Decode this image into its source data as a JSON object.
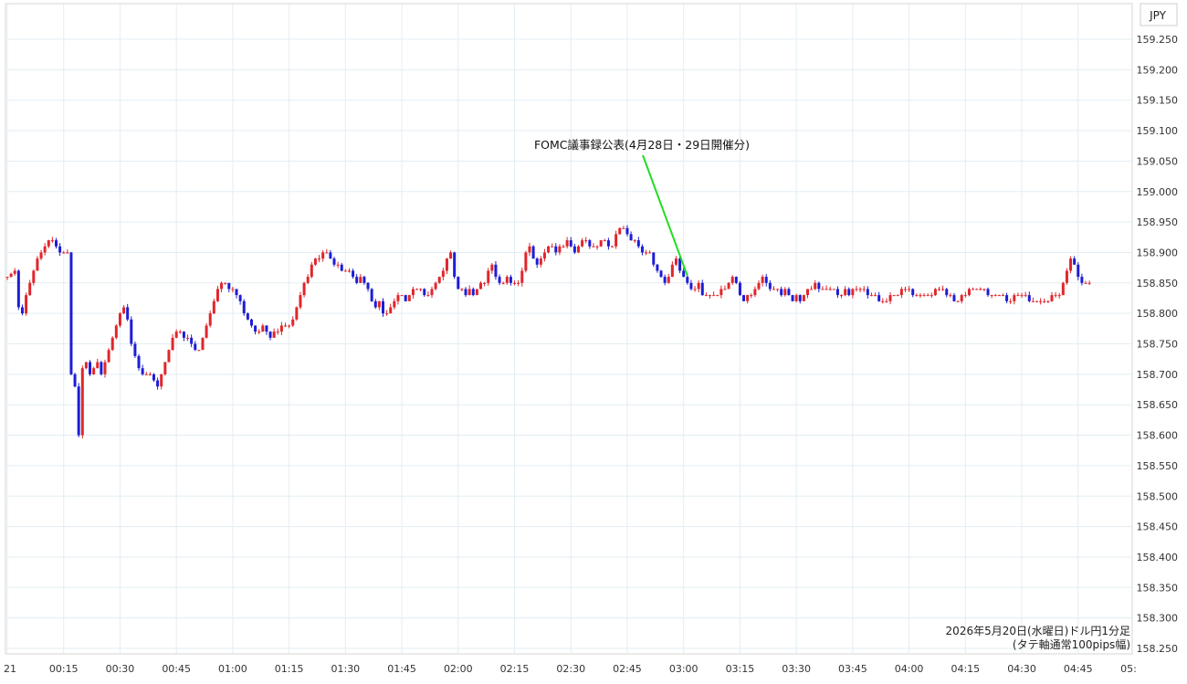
{
  "chart_data": {
    "type": "candlestick",
    "currency_label": "JPY",
    "annotation": "FOMC議事録公表(4月28日・29日開催分)",
    "caption_line1": "2026年5月20日(水曜日)ドル円1分足",
    "caption_line2": "(タテ軸通常100pips幅)",
    "ylim": [
      158.25,
      159.25
    ],
    "y_ticks": [
      "159.250",
      "159.200",
      "159.150",
      "159.100",
      "159.050",
      "159.000",
      "158.950",
      "158.900",
      "158.850",
      "158.800",
      "158.750",
      "158.700",
      "158.650",
      "158.600",
      "158.550",
      "158.500",
      "158.450",
      "158.400",
      "158.350",
      "158.300",
      "158.250"
    ],
    "x_ticks": [
      {
        "minute": 0,
        "label": "21"
      },
      {
        "minute": 15,
        "label": "00:15"
      },
      {
        "minute": 30,
        "label": "00:30"
      },
      {
        "minute": 45,
        "label": "00:45"
      },
      {
        "minute": 60,
        "label": "01:00"
      },
      {
        "minute": 75,
        "label": "01:15"
      },
      {
        "minute": 90,
        "label": "01:30"
      },
      {
        "minute": 105,
        "label": "01:45"
      },
      {
        "minute": 120,
        "label": "02:00"
      },
      {
        "minute": 135,
        "label": "02:15"
      },
      {
        "minute": 150,
        "label": "02:30"
      },
      {
        "minute": 165,
        "label": "02:45"
      },
      {
        "minute": 180,
        "label": "03:00"
      },
      {
        "minute": 195,
        "label": "03:15"
      },
      {
        "minute": 210,
        "label": "03:30"
      },
      {
        "minute": 225,
        "label": "03:45"
      },
      {
        "minute": 240,
        "label": "04:00"
      },
      {
        "minute": 255,
        "label": "04:15"
      },
      {
        "minute": 270,
        "label": "04:30"
      },
      {
        "minute": 285,
        "label": "04:45"
      },
      {
        "minute": 300,
        "label": "05:"
      }
    ],
    "annotation_minute": 181,
    "up_color": "#e0262b",
    "down_color": "#1d1dd6",
    "arrow_color": "#22dd22",
    "grid": true,
    "close_path": [
      [
        0,
        158.86
      ],
      [
        2,
        158.87
      ],
      [
        3,
        158.81
      ],
      [
        4,
        158.8
      ],
      [
        5,
        158.83
      ],
      [
        6,
        158.85
      ],
      [
        7,
        158.87
      ],
      [
        8,
        158.89
      ],
      [
        9,
        158.9
      ],
      [
        10,
        158.91
      ],
      [
        11,
        158.92
      ],
      [
        12,
        158.92
      ],
      [
        13,
        158.91
      ],
      [
        14,
        158.9
      ],
      [
        15,
        158.9
      ],
      [
        16,
        158.9
      ],
      [
        17,
        158.7
      ],
      [
        18,
        158.68
      ],
      [
        19,
        158.6
      ],
      [
        20,
        158.71
      ],
      [
        21,
        158.72
      ],
      [
        22,
        158.7
      ],
      [
        23,
        158.71
      ],
      [
        24,
        158.72
      ],
      [
        25,
        158.7
      ],
      [
        26,
        158.72
      ],
      [
        27,
        158.74
      ],
      [
        28,
        158.76
      ],
      [
        29,
        158.78
      ],
      [
        30,
        158.8
      ],
      [
        31,
        158.81
      ],
      [
        32,
        158.79
      ],
      [
        33,
        158.75
      ],
      [
        34,
        158.73
      ],
      [
        35,
        158.71
      ],
      [
        36,
        158.7
      ],
      [
        37,
        158.7
      ],
      [
        38,
        158.7
      ],
      [
        39,
        158.69
      ],
      [
        40,
        158.68
      ],
      [
        41,
        158.7
      ],
      [
        42,
        158.72
      ],
      [
        43,
        158.74
      ],
      [
        44,
        158.76
      ],
      [
        45,
        158.77
      ],
      [
        46,
        158.77
      ],
      [
        47,
        158.76
      ],
      [
        48,
        158.76
      ],
      [
        49,
        158.75
      ],
      [
        50,
        158.74
      ],
      [
        51,
        158.74
      ],
      [
        52,
        158.76
      ],
      [
        53,
        158.78
      ],
      [
        54,
        158.8
      ],
      [
        55,
        158.82
      ],
      [
        56,
        158.84
      ],
      [
        57,
        158.85
      ],
      [
        58,
        158.85
      ],
      [
        59,
        158.84
      ],
      [
        60,
        158.84
      ],
      [
        61,
        158.83
      ],
      [
        62,
        158.82
      ],
      [
        63,
        158.8
      ],
      [
        64,
        158.79
      ],
      [
        65,
        158.78
      ],
      [
        66,
        158.77
      ],
      [
        67,
        158.77
      ],
      [
        68,
        158.78
      ],
      [
        69,
        158.77
      ],
      [
        70,
        158.76
      ],
      [
        71,
        158.77
      ],
      [
        72,
        158.77
      ],
      [
        73,
        158.78
      ],
      [
        74,
        158.78
      ],
      [
        75,
        158.78
      ],
      [
        76,
        158.79
      ],
      [
        77,
        158.81
      ],
      [
        78,
        158.83
      ],
      [
        79,
        158.85
      ],
      [
        80,
        158.86
      ],
      [
        81,
        158.88
      ],
      [
        82,
        158.89
      ],
      [
        83,
        158.89
      ],
      [
        84,
        158.9
      ],
      [
        85,
        158.9
      ],
      [
        86,
        158.89
      ],
      [
        87,
        158.88
      ],
      [
        88,
        158.88
      ],
      [
        89,
        158.87
      ],
      [
        90,
        158.87
      ],
      [
        91,
        158.87
      ],
      [
        92,
        158.86
      ],
      [
        93,
        158.85
      ],
      [
        94,
        158.86
      ],
      [
        95,
        158.85
      ],
      [
        96,
        158.84
      ],
      [
        97,
        158.82
      ],
      [
        98,
        158.81
      ],
      [
        99,
        158.82
      ],
      [
        100,
        158.8
      ],
      [
        101,
        158.8
      ],
      [
        102,
        158.81
      ],
      [
        103,
        158.82
      ],
      [
        104,
        158.83
      ],
      [
        105,
        158.83
      ],
      [
        106,
        158.82
      ],
      [
        107,
        158.83
      ],
      [
        108,
        158.84
      ],
      [
        109,
        158.84
      ],
      [
        110,
        158.84
      ],
      [
        111,
        158.83
      ],
      [
        112,
        158.83
      ],
      [
        113,
        158.84
      ],
      [
        114,
        158.85
      ],
      [
        115,
        158.86
      ],
      [
        116,
        158.87
      ],
      [
        117,
        158.89
      ],
      [
        118,
        158.9
      ],
      [
        119,
        158.86
      ],
      [
        120,
        158.84
      ],
      [
        121,
        158.84
      ],
      [
        122,
        158.83
      ],
      [
        123,
        158.84
      ],
      [
        124,
        158.83
      ],
      [
        125,
        158.84
      ],
      [
        126,
        158.85
      ],
      [
        127,
        158.85
      ],
      [
        128,
        158.87
      ],
      [
        129,
        158.88
      ],
      [
        130,
        158.86
      ],
      [
        131,
        158.85
      ],
      [
        132,
        158.85
      ],
      [
        133,
        158.86
      ],
      [
        134,
        158.85
      ],
      [
        135,
        158.85
      ],
      [
        136,
        158.85
      ],
      [
        137,
        158.87
      ],
      [
        138,
        158.9
      ],
      [
        139,
        158.91
      ],
      [
        140,
        158.89
      ],
      [
        141,
        158.88
      ],
      [
        142,
        158.89
      ],
      [
        143,
        158.9
      ],
      [
        144,
        158.91
      ],
      [
        145,
        158.91
      ],
      [
        146,
        158.9
      ],
      [
        147,
        158.91
      ],
      [
        148,
        158.91
      ],
      [
        149,
        158.92
      ],
      [
        150,
        158.91
      ],
      [
        151,
        158.9
      ],
      [
        152,
        158.91
      ],
      [
        153,
        158.92
      ],
      [
        154,
        158.92
      ],
      [
        155,
        158.91
      ],
      [
        156,
        158.91
      ],
      [
        157,
        158.91
      ],
      [
        158,
        158.92
      ],
      [
        159,
        158.92
      ],
      [
        160,
        158.91
      ],
      [
        161,
        158.91
      ],
      [
        162,
        158.93
      ],
      [
        163,
        158.94
      ],
      [
        164,
        158.94
      ],
      [
        165,
        158.93
      ],
      [
        166,
        158.92
      ],
      [
        167,
        158.92
      ],
      [
        168,
        158.91
      ],
      [
        169,
        158.9
      ],
      [
        170,
        158.9
      ],
      [
        171,
        158.9
      ],
      [
        172,
        158.88
      ],
      [
        173,
        158.87
      ],
      [
        174,
        158.86
      ],
      [
        175,
        158.85
      ],
      [
        176,
        158.86
      ],
      [
        177,
        158.88
      ],
      [
        178,
        158.89
      ],
      [
        179,
        158.87
      ],
      [
        180,
        158.86
      ],
      [
        181,
        158.85
      ],
      [
        182,
        158.84
      ],
      [
        183,
        158.84
      ],
      [
        184,
        158.85
      ],
      [
        185,
        158.83
      ],
      [
        186,
        158.83
      ],
      [
        187,
        158.83
      ],
      [
        188,
        158.83
      ],
      [
        189,
        158.83
      ],
      [
        190,
        158.84
      ],
      [
        191,
        158.84
      ],
      [
        192,
        158.85
      ],
      [
        193,
        158.86
      ],
      [
        194,
        158.85
      ],
      [
        195,
        158.83
      ],
      [
        196,
        158.82
      ],
      [
        197,
        158.83
      ],
      [
        198,
        158.83
      ],
      [
        199,
        158.84
      ],
      [
        200,
        158.85
      ],
      [
        201,
        158.86
      ],
      [
        202,
        158.85
      ],
      [
        203,
        158.84
      ],
      [
        204,
        158.84
      ],
      [
        205,
        158.84
      ],
      [
        206,
        158.83
      ],
      [
        207,
        158.84
      ],
      [
        208,
        158.83
      ],
      [
        209,
        158.82
      ],
      [
        210,
        158.83
      ],
      [
        211,
        158.82
      ],
      [
        212,
        158.83
      ],
      [
        213,
        158.84
      ],
      [
        214,
        158.84
      ],
      [
        215,
        158.85
      ],
      [
        216,
        158.84
      ],
      [
        217,
        158.84
      ],
      [
        218,
        158.84
      ],
      [
        219,
        158.84
      ],
      [
        220,
        158.84
      ],
      [
        221,
        158.83
      ],
      [
        222,
        158.83
      ],
      [
        223,
        158.84
      ],
      [
        224,
        158.83
      ],
      [
        225,
        158.84
      ],
      [
        226,
        158.84
      ],
      [
        227,
        158.84
      ],
      [
        228,
        158.84
      ],
      [
        229,
        158.83
      ],
      [
        230,
        158.83
      ],
      [
        231,
        158.83
      ],
      [
        232,
        158.82
      ],
      [
        233,
        158.82
      ],
      [
        234,
        158.82
      ],
      [
        235,
        158.83
      ],
      [
        236,
        158.83
      ],
      [
        237,
        158.83
      ],
      [
        238,
        158.84
      ],
      [
        239,
        158.84
      ],
      [
        240,
        158.84
      ],
      [
        241,
        158.83
      ],
      [
        242,
        158.83
      ],
      [
        243,
        158.83
      ],
      [
        244,
        158.83
      ],
      [
        245,
        158.83
      ],
      [
        246,
        158.83
      ],
      [
        247,
        158.84
      ],
      [
        248,
        158.84
      ],
      [
        249,
        158.84
      ],
      [
        250,
        158.83
      ],
      [
        251,
        158.83
      ],
      [
        252,
        158.82
      ],
      [
        253,
        158.82
      ],
      [
        254,
        158.83
      ],
      [
        255,
        158.83
      ],
      [
        256,
        158.84
      ],
      [
        257,
        158.84
      ],
      [
        258,
        158.84
      ],
      [
        259,
        158.84
      ],
      [
        260,
        158.84
      ],
      [
        261,
        158.83
      ],
      [
        262,
        158.83
      ],
      [
        263,
        158.83
      ],
      [
        264,
        158.83
      ],
      [
        265,
        158.83
      ],
      [
        266,
        158.82
      ],
      [
        267,
        158.82
      ],
      [
        268,
        158.83
      ],
      [
        269,
        158.83
      ],
      [
        270,
        158.83
      ],
      [
        271,
        158.83
      ],
      [
        272,
        158.82
      ],
      [
        273,
        158.82
      ],
      [
        274,
        158.82
      ],
      [
        275,
        158.82
      ],
      [
        276,
        158.82
      ],
      [
        277,
        158.82
      ],
      [
        278,
        158.83
      ],
      [
        279,
        158.83
      ],
      [
        280,
        158.83
      ],
      [
        281,
        158.85
      ],
      [
        282,
        158.87
      ],
      [
        283,
        158.89
      ],
      [
        284,
        158.88
      ],
      [
        285,
        158.86
      ],
      [
        286,
        158.85
      ],
      [
        287,
        158.85
      ],
      [
        288,
        158.85
      ]
    ]
  }
}
